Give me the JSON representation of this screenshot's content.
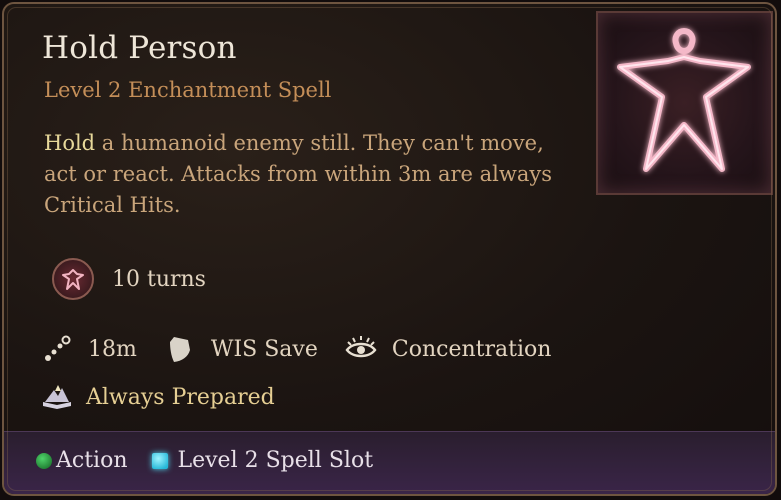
{
  "spell": {
    "name": "Hold Person",
    "subtitle": "Level 2 Enchantment Spell",
    "description_keyword": "Hold",
    "description_rest": " a humanoid enemy still. They can't move, act or react. Attacks from within 3m are always Critical Hits.",
    "art_icon": "hold-person-spell-art"
  },
  "duration": {
    "icon": "hold-person-icon",
    "text": "10 turns"
  },
  "properties": [
    {
      "icon": "range-icon",
      "text": "18m"
    },
    {
      "icon": "shield-icon",
      "text": "WIS Save"
    },
    {
      "icon": "concentration-icon",
      "text": "Concentration"
    }
  ],
  "prepared": {
    "icon": "spellbook-icon",
    "text": "Always Prepared"
  },
  "costs": [
    {
      "icon": "action-dot",
      "text": "Action",
      "color": "#3cbf55"
    },
    {
      "icon": "spell-slot-square",
      "text": "Level 2 Spell Slot",
      "color": "#3ccfe8"
    }
  ],
  "colors": {
    "title": "#eee6d8",
    "subtitle": "#c48e58",
    "description": "#c9a57b",
    "keyword": "#e7d89a",
    "prepared": "#e6cf94",
    "footer": "#3a2548"
  }
}
